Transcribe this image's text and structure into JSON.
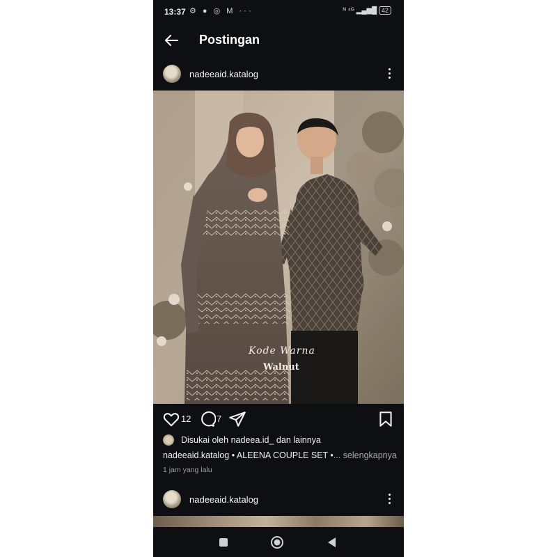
{
  "status_bar": {
    "time": "13:37",
    "notification_icons": "⚙ ● ◎ M ···",
    "right_icons": "ᴺ ⁴ᴳ ▂▄▆█",
    "battery": "42"
  },
  "app_bar": {
    "title": "Postingan",
    "back_icon": "arrow-left-icon"
  },
  "post": {
    "username": "nadeeaid.katalog",
    "image_overlay": {
      "line1": "Kode Warna",
      "line2": "Walnut"
    },
    "like_count": "12",
    "comment_count": "7",
    "liked_by_prefix": "Disukai oleh ",
    "liked_by_user": "nadeea.id_",
    "liked_by_suffix": " dan lainnya",
    "caption_user": "nadeeaid.katalog",
    "caption_text": " • ALEENA COUPLE SET •",
    "caption_more": "... selengkapnya",
    "time_ago": "1 jam yang lalu"
  },
  "next_post": {
    "username": "nadeeaid.katalog"
  },
  "colors": {
    "background": "#0d0f12",
    "text": "#f2f2f2",
    "muted": "#a0a0a0"
  }
}
